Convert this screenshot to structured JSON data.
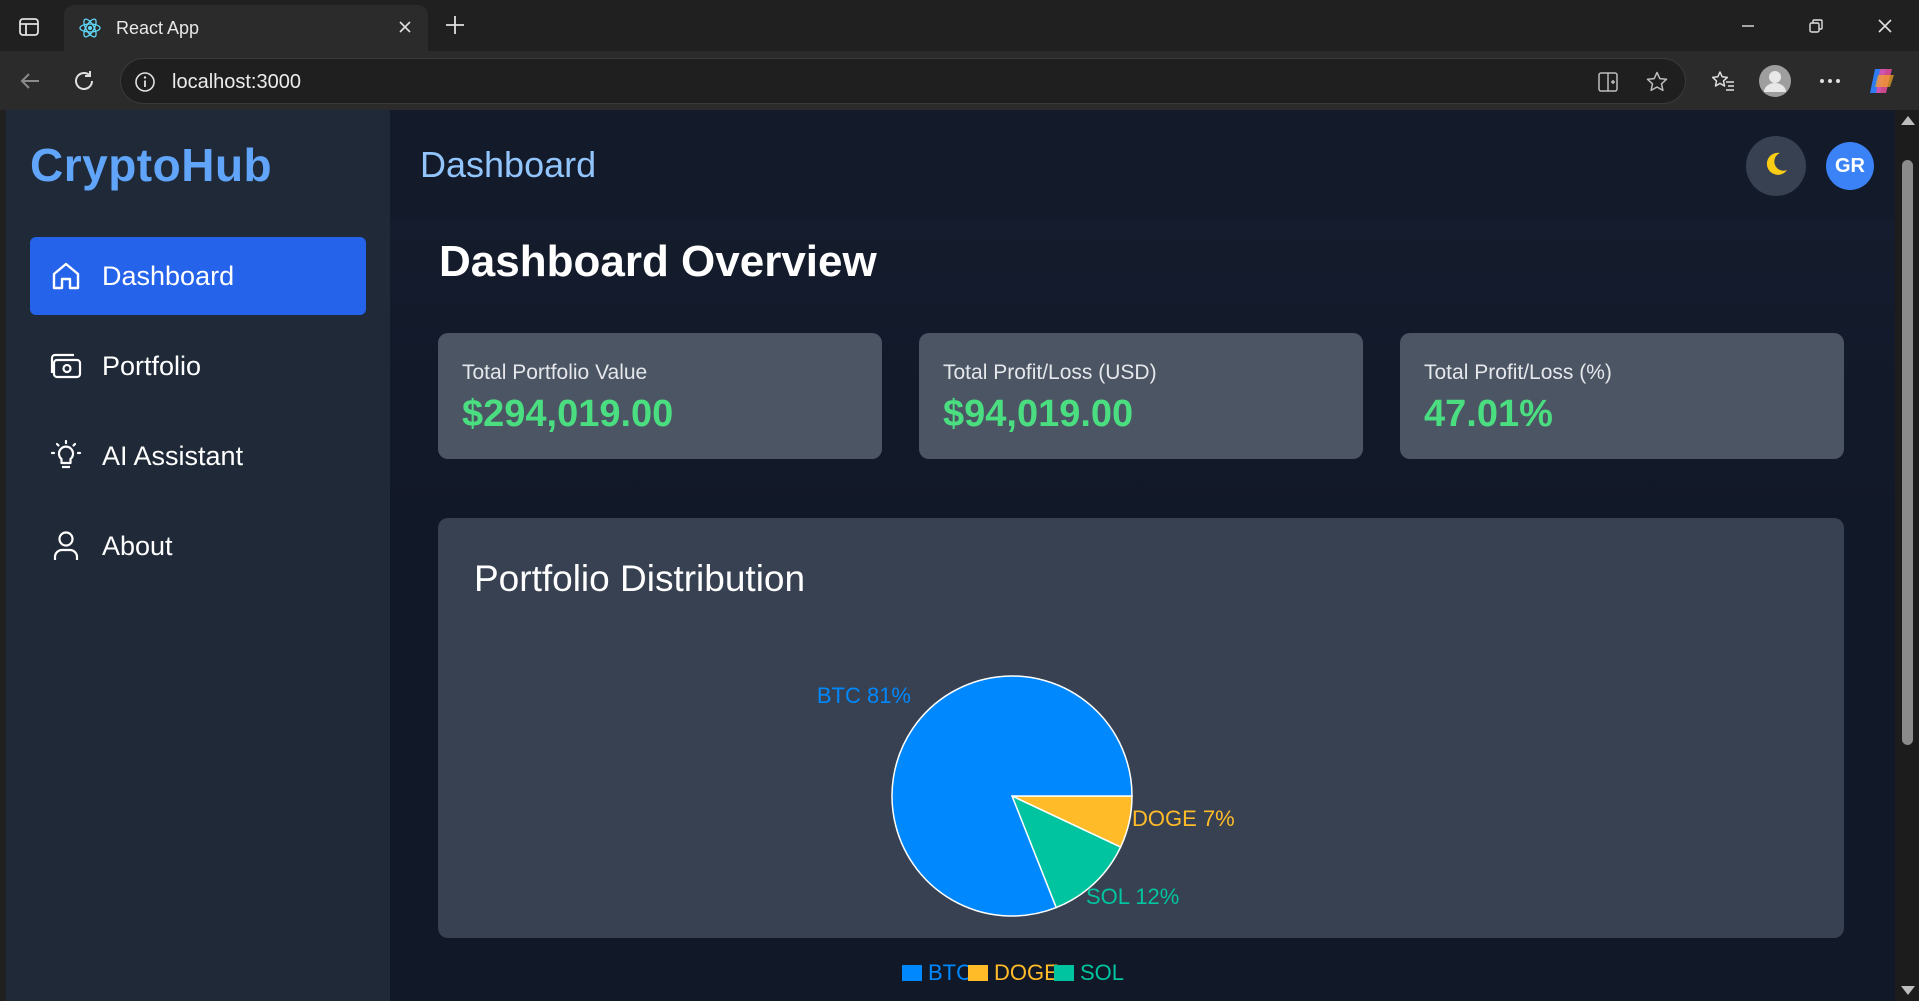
{
  "browser": {
    "tab_title": "React App",
    "url": "localhost:3000",
    "icons": {
      "sidebar_toggle": "tab-sidebar-icon",
      "favicon": "react-logo-icon",
      "close": "close-icon",
      "new_tab": "plus-icon",
      "back": "back-arrow-icon",
      "reload": "reload-icon",
      "info": "info-icon",
      "split": "split-screen-icon",
      "favorite": "star-icon",
      "favorites": "favorites-icon",
      "profile": "profile-icon",
      "more": "more-icon",
      "copilot": "copilot-icon"
    }
  },
  "sidebar": {
    "brand": "CryptoHub",
    "items": [
      {
        "label": "Dashboard",
        "icon": "home-icon",
        "active": true
      },
      {
        "label": "Portfolio",
        "icon": "wallet-icon",
        "active": false
      },
      {
        "label": "AI Assistant",
        "icon": "lightbulb-icon",
        "active": false
      },
      {
        "label": "About",
        "icon": "user-icon",
        "active": false
      }
    ]
  },
  "header": {
    "title": "Dashboard",
    "theme_icon": "moon-icon",
    "avatar_initials": "GR"
  },
  "main": {
    "overview_title": "Dashboard Overview",
    "cards": [
      {
        "label": "Total Portfolio Value",
        "value": "$294,019.00"
      },
      {
        "label": "Total Profit/Loss (USD)",
        "value": "$94,019.00"
      },
      {
        "label": "Total Profit/Loss (%)",
        "value": "47.01%"
      }
    ],
    "distribution_title": "Portfolio Distribution"
  },
  "colors": {
    "accent": "#2563eb",
    "brand": "#60a5fa",
    "positive": "#4ade80",
    "btc": "#0088fe",
    "doge": "#ffbb28",
    "sol": "#00c49f"
  },
  "chart_data": {
    "type": "pie",
    "title": "Portfolio Distribution",
    "categories": [
      "BTC",
      "DOGE",
      "SOL"
    ],
    "values": [
      81,
      7,
      12
    ],
    "labels": [
      "BTC 81%",
      "DOGE 7%",
      "SOL 12%"
    ],
    "colors": [
      "#0088fe",
      "#ffbb28",
      "#00c49f"
    ],
    "legend": "bottom"
  }
}
